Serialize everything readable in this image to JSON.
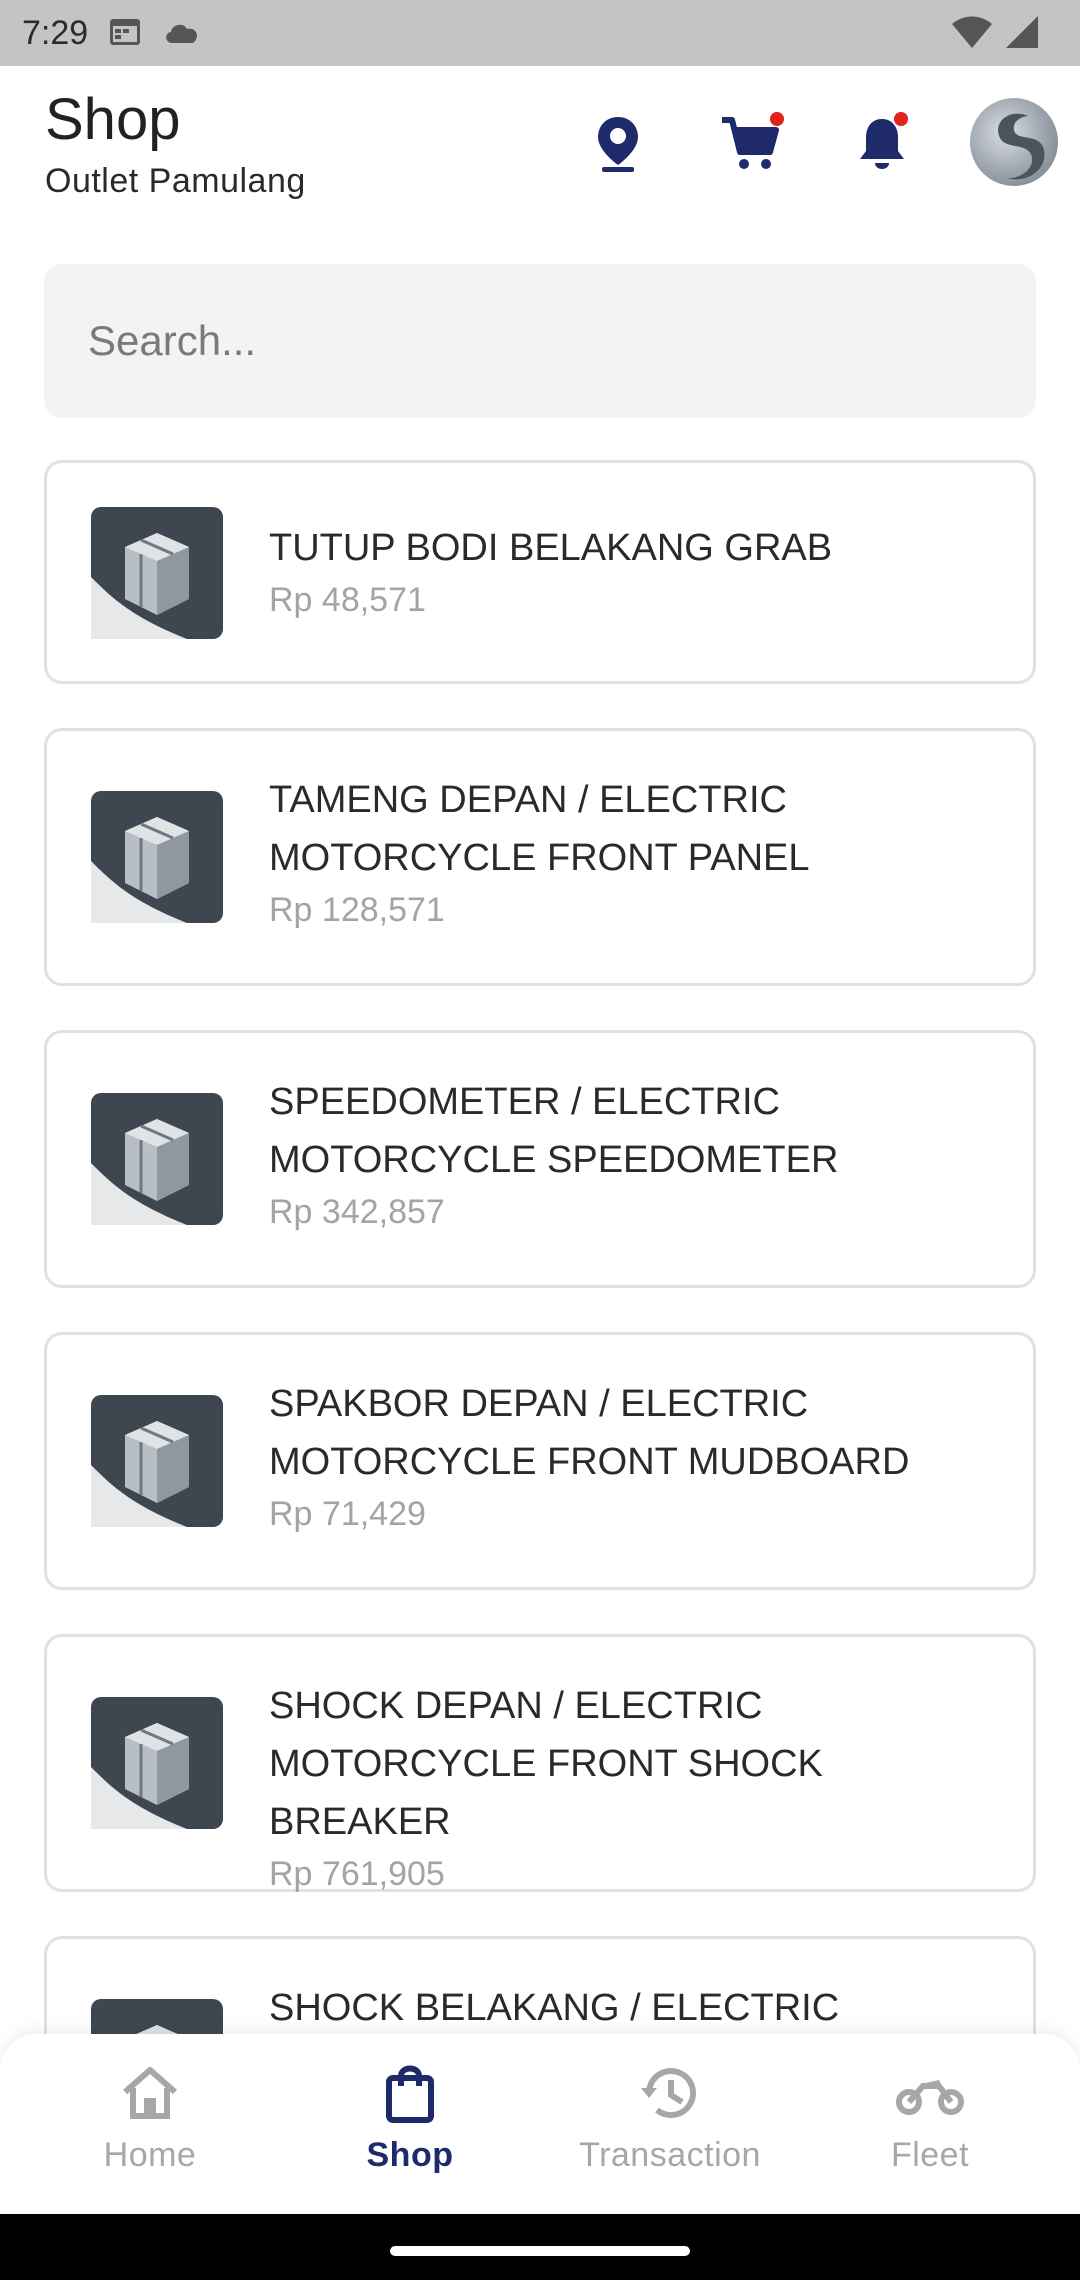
{
  "status_bar": {
    "time": "7:29",
    "icons": [
      "calendar-icon",
      "cloud-icon",
      "wifi-icon",
      "signal-icon"
    ]
  },
  "header": {
    "title": "Shop",
    "subtitle": "Outlet Pamulang",
    "icons": [
      "location-pin-icon",
      "cart-icon",
      "bell-icon",
      "avatar"
    ],
    "accent_color": "#1f2a6b",
    "badge_color": "#e0231c"
  },
  "search": {
    "placeholder": "Search..."
  },
  "products": [
    {
      "line1": "TUTUP BODI BELAKANG GRAB",
      "line2": "",
      "price": "Rp 48,571"
    },
    {
      "line1": "TAMENG DEPAN / ELECTRIC",
      "line2": "MOTORCYCLE FRONT PANEL",
      "price": "Rp 128,571"
    },
    {
      "line1": "SPEEDOMETER / ELECTRIC",
      "line2": "MOTORCYCLE SPEEDOMETER",
      "price": "Rp 342,857"
    },
    {
      "line1": "SPAKBOR DEPAN / ELECTRIC",
      "line2": "MOTORCYCLE FRONT MUDBOARD",
      "price": "Rp 71,429"
    },
    {
      "line1": "SHOCK DEPAN / ELECTRIC",
      "line2": "MOTORCYCLE FRONT SHOCK BREAKER",
      "price": "Rp 761,905"
    },
    {
      "line1": "SHOCK BELAKANG / ELECTRIC",
      "line2": "",
      "price": ""
    }
  ],
  "bottom_nav": {
    "items": [
      {
        "label": "Home",
        "icon": "home-icon",
        "active": false
      },
      {
        "label": "Shop",
        "icon": "shopping-bag-icon",
        "active": true
      },
      {
        "label": "Transaction",
        "icon": "history-icon",
        "active": false
      },
      {
        "label": "Fleet",
        "icon": "motorcycle-icon",
        "active": false
      }
    ]
  }
}
